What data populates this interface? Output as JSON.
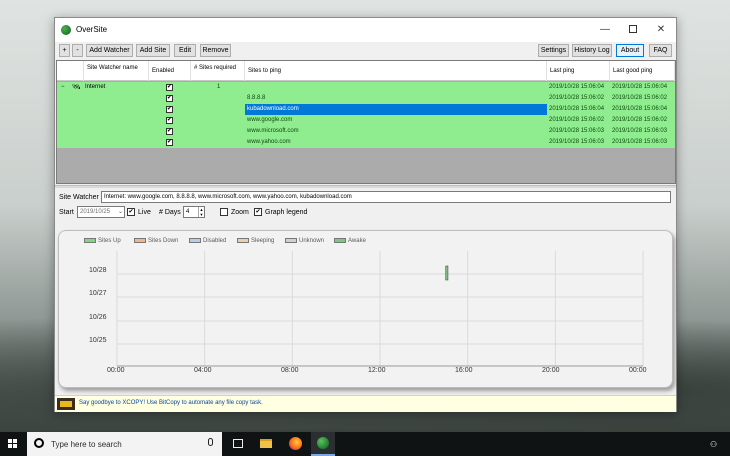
{
  "window": {
    "title": "OverSite",
    "controls": {
      "minimize": "—",
      "close": "✕"
    }
  },
  "toolbar": {
    "plus": "+",
    "minus": "-",
    "add_watcher": "Add Watcher",
    "add_site": "Add Site",
    "edit": "Edit",
    "remove": "Remove",
    "settings": "Settings",
    "history_log": "History Log",
    "about": "About",
    "faq": "FAQ"
  },
  "grid": {
    "headers": {
      "site_watcher": "Site Watcher name",
      "enabled": "Enabled",
      "sites_required": "# Sites required",
      "sites_to_ping": "Sites to ping",
      "last_ping": "Last ping",
      "last_good_ping": "Last good ping"
    },
    "watcher": {
      "expander": "−",
      "name": "Internet",
      "enabled": "✔",
      "sites_required": "1",
      "last_ping": "2019/10/28 15:06:04",
      "last_good_ping": "2019/10/28 15:06:04"
    },
    "rows": [
      {
        "enabled": "✔",
        "site": "8.8.8.8",
        "last_ping": "2019/10/28 15:06:02",
        "last_good_ping": "2019/10/28 15:06:02"
      },
      {
        "enabled": "✔",
        "site": "kubadownload.com",
        "last_ping": "2019/10/28 15:06:04",
        "last_good_ping": "2019/10/28 15:06:04"
      },
      {
        "enabled": "✔",
        "site": "www.google.com",
        "last_ping": "2019/10/28 15:06:02",
        "last_good_ping": "2019/10/28 15:06:02"
      },
      {
        "enabled": "✔",
        "site": "www.microsoft.com",
        "last_ping": "2019/10/28 15:06:03",
        "last_good_ping": "2019/10/28 15:06:03"
      },
      {
        "enabled": "✔",
        "site": "www.yahoo.com",
        "last_ping": "2019/10/28 15:06:03",
        "last_good_ping": "2019/10/28 15:06:03"
      }
    ]
  },
  "details": {
    "site_watcher_label": "Site Watcher",
    "site_watcher_value": "Internet: www.google.com, 8.8.8.8, www.microsoft.com, www.yahoo.com, kubadownload.com",
    "start_label": "Start",
    "start_date": "2019/10/25",
    "live_label": "Live",
    "live_checked": "✔",
    "days_label": "# Days",
    "days_value": "4",
    "zoom_label": "Zoom",
    "graph_legend_label": "Graph legend",
    "graph_legend_checked": "✔"
  },
  "chart_data": {
    "type": "scatter",
    "legend": [
      {
        "name": "Sites Up",
        "color": "#7fd87f"
      },
      {
        "name": "Sites Down",
        "color": "#f3b38f"
      },
      {
        "name": "Disabled",
        "color": "#b5cde8"
      },
      {
        "name": "Sleeping",
        "color": "#e8cfb0"
      },
      {
        "name": "Unknown",
        "color": "#d0d0d0"
      },
      {
        "name": "Awake",
        "color": "#7fc77f"
      }
    ],
    "x_ticks": [
      "00:00",
      "04:00",
      "08:00",
      "12:00",
      "16:00",
      "20:00",
      "00:00"
    ],
    "y_ticks": [
      "10/28",
      "10/27",
      "10/26",
      "10/25"
    ],
    "xlim_hours": [
      0,
      24
    ],
    "ylim_days": [
      "10/25",
      "10/28"
    ],
    "grid": true,
    "legend_placement": "top-left",
    "series": [
      {
        "name": "Awake",
        "points": [
          {
            "day": "10/28",
            "hour_start": 15.0,
            "hour_end": 15.1
          }
        ]
      }
    ]
  },
  "status_bar": {
    "message": "Say goodbye to XCOPY! Use BitCopy to automate any file copy task."
  },
  "taskbar": {
    "search_placeholder": "Type here to search"
  },
  "colors": {
    "row_green": "#8fed8f",
    "selection_blue": "#0078d7",
    "status_yellow": "#ffffe1"
  }
}
